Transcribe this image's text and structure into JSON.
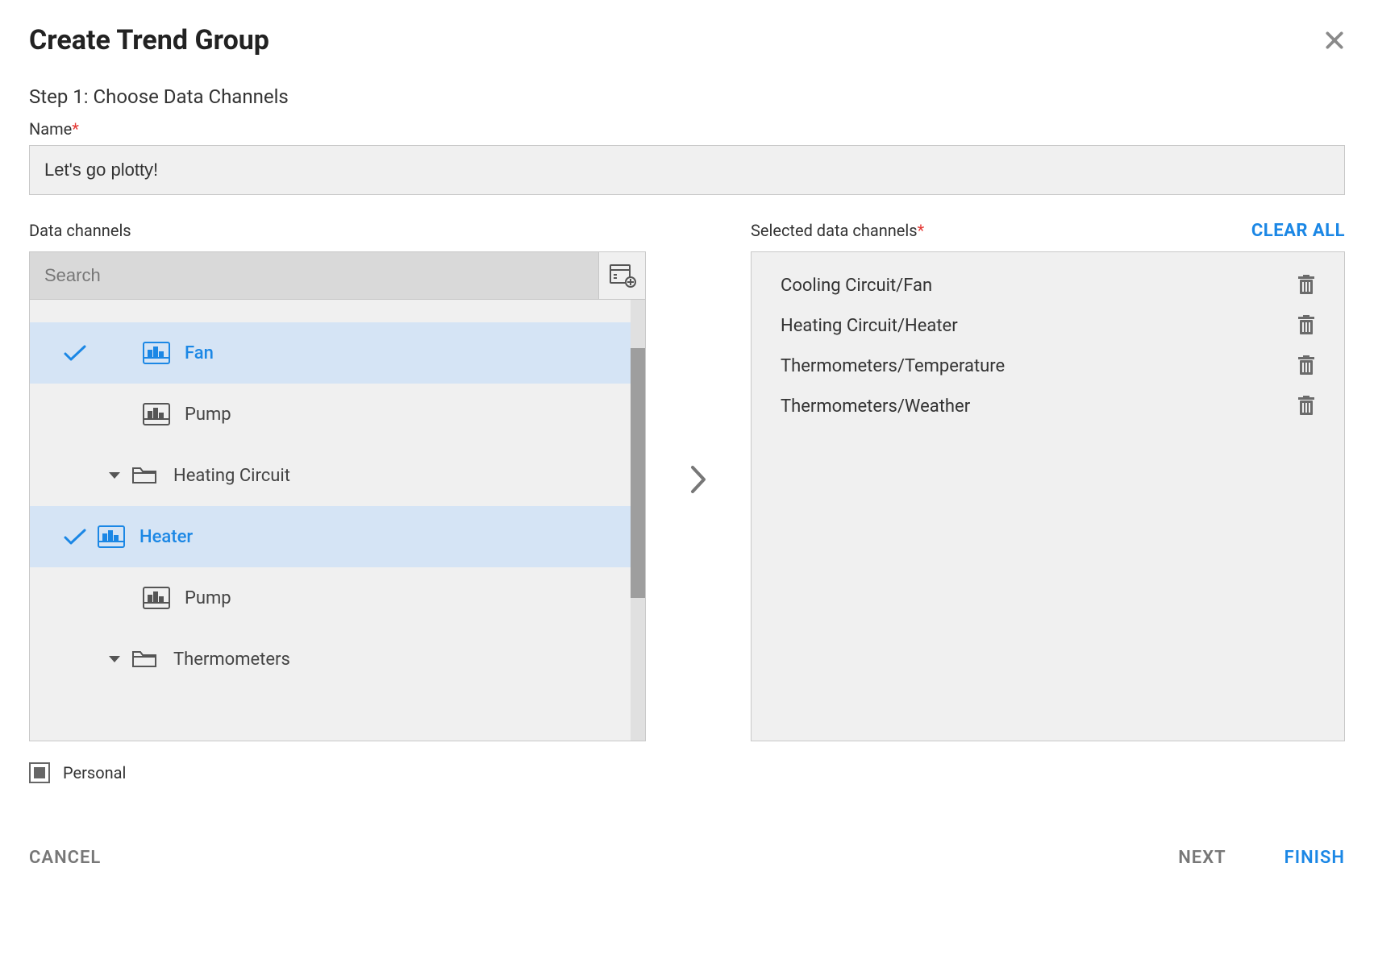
{
  "dialog": {
    "title": "Create Trend Group",
    "step_label": "Step 1: Choose Data Channels",
    "name_label": "Name",
    "name_value": "Let's go plotty!",
    "data_channels_label": "Data channels",
    "selected_channels_label": "Selected data channels",
    "clear_all_label": "CLEAR ALL",
    "search_placeholder": "Search",
    "personal_label": "Personal",
    "cancel_label": "CANCEL",
    "next_label": "NEXT",
    "finish_label": "FINISH"
  },
  "tree": {
    "items": [
      {
        "type": "leaf",
        "label": "Fan",
        "selected": true
      },
      {
        "type": "leaf",
        "label": "Pump",
        "selected": false
      },
      {
        "type": "folder",
        "label": "Heating Circuit",
        "expanded": true
      },
      {
        "type": "leaf",
        "label": "Heater",
        "selected": true
      },
      {
        "type": "leaf",
        "label": "Pump",
        "selected": false
      },
      {
        "type": "folder",
        "label": "Thermometers",
        "expanded": true
      }
    ]
  },
  "selected": [
    {
      "label": "Cooling Circuit/Fan"
    },
    {
      "label": "Heating Circuit/Heater"
    },
    {
      "label": "Thermometers/Temperature"
    },
    {
      "label": "Thermometers/Weather"
    }
  ],
  "colors": {
    "accent": "#1b87e5"
  }
}
